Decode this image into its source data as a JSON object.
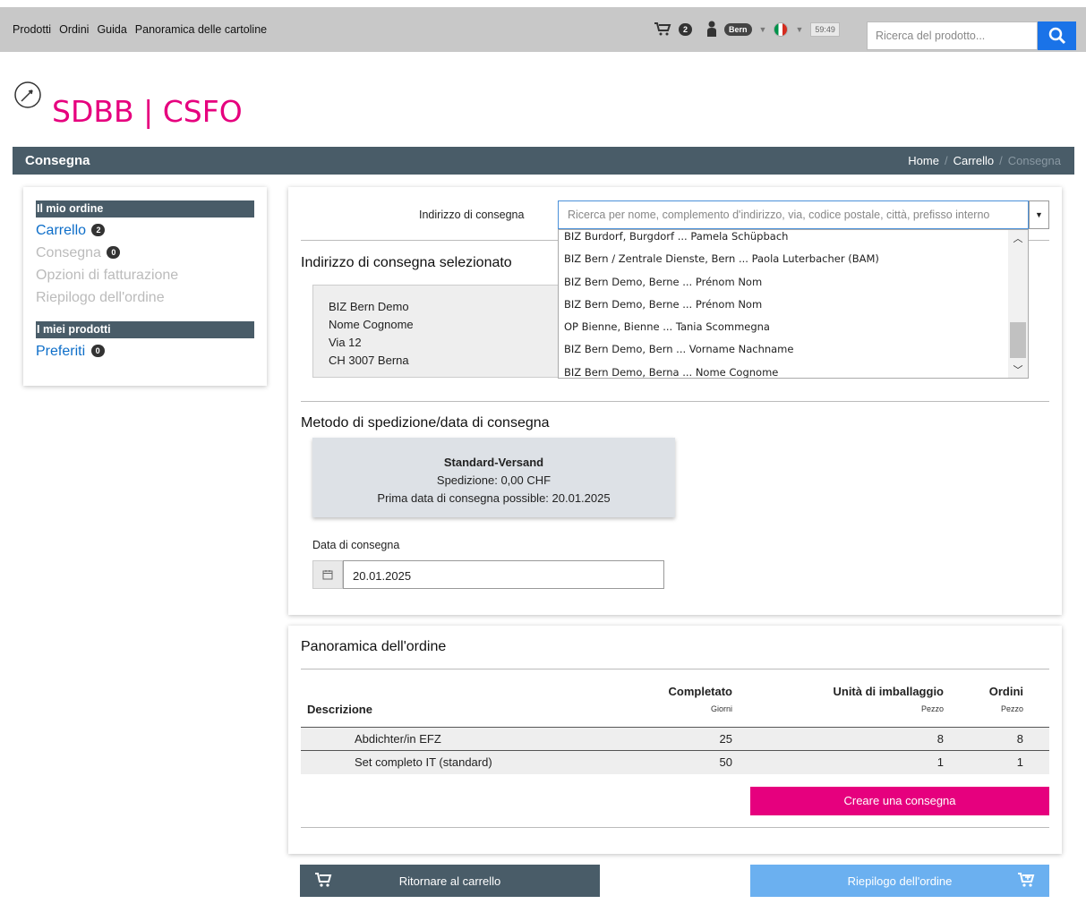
{
  "topnav": {
    "items": [
      "Prodotti",
      "Ordini",
      "Guida",
      "Panoramica delle cartoline"
    ],
    "cart_count": "2",
    "user_badge": "Bern",
    "timer": "59:49",
    "search_placeholder": "Ricerca del prodotto..."
  },
  "logo": {
    "text": "SDBB | CSFO"
  },
  "header": {
    "title": "Consegna",
    "breadcrumb": [
      "Home",
      "Carrello",
      "Consegna"
    ]
  },
  "sidebar": {
    "section1": "Il mio ordine",
    "items": [
      {
        "label": "Carrello",
        "badge": "2"
      },
      {
        "label": "Consegna",
        "badge": "0"
      },
      {
        "label": "Opzioni di fatturazione"
      },
      {
        "label": "Riepilogo dell'ordine"
      }
    ],
    "section2": "I miei prodotti",
    "favorites": {
      "label": "Preferiti",
      "badge": "0"
    }
  },
  "delivery": {
    "address_label": "Indirizzo di consegna",
    "address_placeholder": "Ricerca per nome, complemento d'indirizzo, via, codice postale, città, prefisso interno",
    "dropdown_options": [
      "BIZ Burdorf, Burgdorf ... Pamela Schüpbach",
      "BIZ Bern / Zentrale Dienste, Bern ... Paola Luterbacher (BAM)",
      "BIZ Bern Demo, Berne ... Prénom Nom",
      "BIZ Bern Demo, Berne ... Prénom Nom",
      "OP Bienne, Bienne ... Tania Scommegna",
      "BIZ Bern Demo, Bern ... Vorname Nachname",
      "BIZ Bern Demo, Berna ... Nome Cognome"
    ],
    "selected_title": "Indirizzo di consegna selezionato",
    "selected_address": [
      "BIZ Bern Demo",
      "Nome Cognome",
      "Via 12",
      "CH 3007 Berna"
    ],
    "shipping_title": "Metodo di spedizione/data di consegna",
    "shipping": {
      "name": "Standard-Versand",
      "cost": "Spedizione: 0,00 CHF",
      "earliest": "Prima data di consegna possible: 20.01.2025"
    },
    "date_label": "Data di consegna",
    "date_value": "20.01.2025"
  },
  "overview": {
    "title": "Panoramica dell'ordine",
    "columns": {
      "description": "Descrizione",
      "completed": "Completato",
      "completed_unit": "Giorni",
      "packaging": "Unità di imballaggio",
      "packaging_unit": "Pezzo",
      "orders": "Ordini",
      "orders_unit": "Pezzo"
    },
    "rows": [
      {
        "description": "Abdichter/in EFZ",
        "completed": "25",
        "packaging": "8",
        "orders": "8"
      },
      {
        "description": "Set completo IT (standard)",
        "completed": "50",
        "packaging": "1",
        "orders": "1"
      }
    ],
    "create_button": "Creare una consegna"
  },
  "footer_buttons": {
    "back": "Ritornare al carrello",
    "summary": "Riepilogo dell'ordine"
  },
  "colors": {
    "brand_pink": "#e6007e",
    "header_slate": "#495c68",
    "link_blue": "#0d6ec9",
    "search_blue": "#1a73e8",
    "summary_blue": "#6bb0f0"
  }
}
